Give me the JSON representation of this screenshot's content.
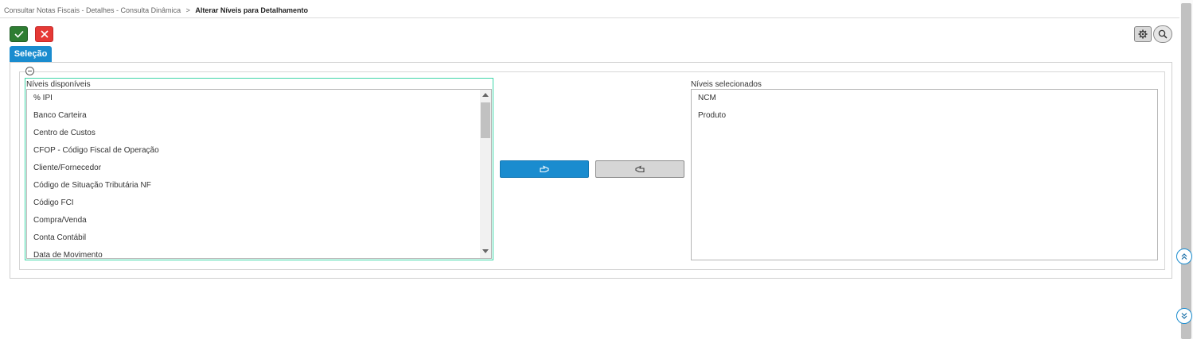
{
  "breadcrumb": {
    "items": [
      "Consultar Notas Fiscais - Detalhes - Consulta Dinâmica"
    ],
    "separator": ">",
    "current": "Alterar Níveis para Detalhamento"
  },
  "toolbar": {
    "confirm_icon": "check-icon",
    "cancel_icon": "close-icon",
    "settings_icon": "gear-icon",
    "search_icon": "search-icon"
  },
  "tabs": [
    {
      "label": "Seleção",
      "active": true
    }
  ],
  "available": {
    "label": "Níveis disponíveis",
    "items": [
      "% IPI",
      "Banco Carteira",
      "Centro de Custos",
      "CFOP - Código Fiscal de Operação",
      "Cliente/Fornecedor",
      "Código de Situação Tributária NF",
      "Código FCI",
      "Compra/Venda",
      "Conta Contábil",
      "Data de Movimento"
    ]
  },
  "selected": {
    "label": "Níveis selecionados",
    "items": [
      "NCM",
      "Produto"
    ]
  },
  "transfer": {
    "add_icon": "hand-point-right-icon",
    "remove_icon": "hand-point-left-icon"
  },
  "colors": {
    "accent": "#1a8ccf",
    "confirm": "#2e7d32",
    "cancel": "#e53935",
    "focus_border": "#3ed6a8"
  }
}
